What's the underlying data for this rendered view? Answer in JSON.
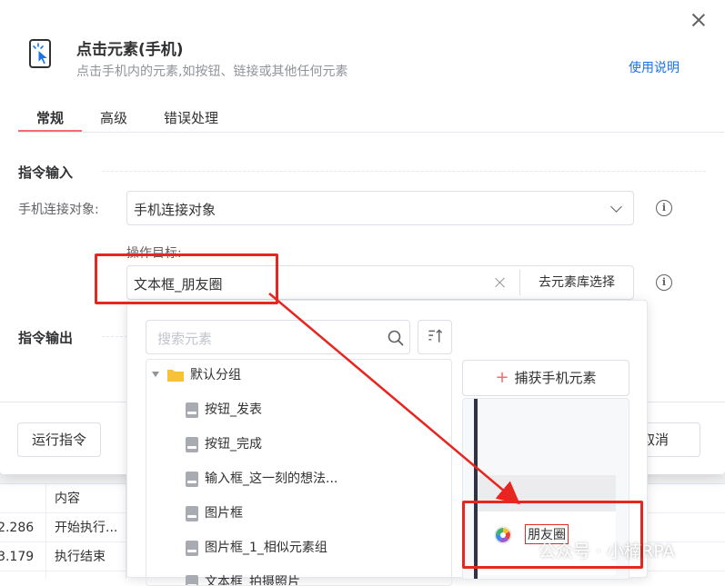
{
  "dialog": {
    "title": "点击元素(手机)",
    "subtitle": "点击手机内的元素,如按钮、链接或其他任何元素",
    "help_link": "使用说明"
  },
  "tabs": [
    {
      "label": "常规",
      "active": true
    },
    {
      "label": "高级",
      "active": false
    },
    {
      "label": "错误处理",
      "active": false
    }
  ],
  "input_section": {
    "title": "指令输入",
    "device_label": "手机连接对象:",
    "device_value": "手机连接对象",
    "target_label": "操作目标:",
    "target_value": "文本框_朋友圈",
    "library_button": "去元素库选择"
  },
  "output_section": {
    "title": "指令输出"
  },
  "footer": {
    "run_button": "运行指令",
    "cancel_button_partial": "取消"
  },
  "element_panel": {
    "search_placeholder": "搜索元素",
    "capture_button": "捕获手机元素",
    "tree": {
      "group": "默认分组",
      "items": [
        "按钮_发表",
        "按钮_完成",
        "输入框_这一刻的想法...",
        "图片框",
        "图片框_1_相似元素组",
        "文本框_拍摄照片"
      ]
    },
    "preview_text": "朋友圈"
  },
  "log_table": {
    "header": "内容",
    "rows": [
      {
        "time": "2.286",
        "content": "开始执行..."
      },
      {
        "time": "3.179",
        "content": "执行结束"
      }
    ]
  },
  "watermark": "公众号 · 小楠RPA",
  "colors": {
    "accent_red": "#e8251f",
    "link_blue": "#1a73e8",
    "tab_underline": "#f56c6c"
  }
}
